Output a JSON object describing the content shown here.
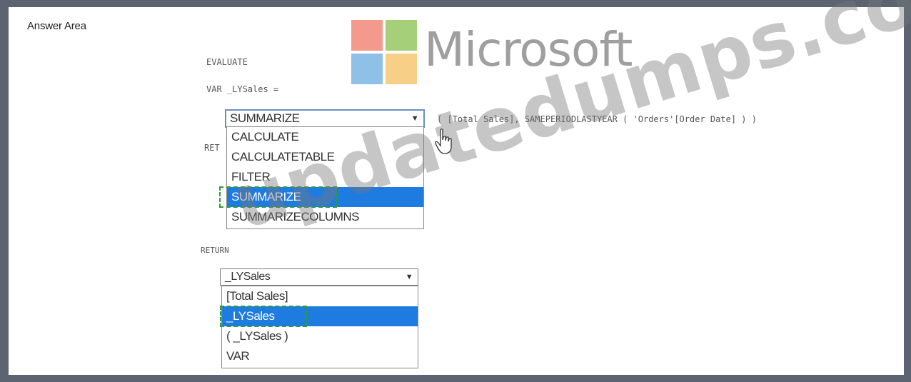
{
  "header": {
    "title": "Answer Area"
  },
  "code": {
    "evaluate": "EVALUATE",
    "var_line": "VAR _LYSales =",
    "func_args": "( [Total Sales], SAMEPERIODLASTYEAR ( 'Orders'[Order Date] ) )",
    "return_partial": "RET",
    "return": "RETURN"
  },
  "dropdown1": {
    "selected": "SUMMARIZE",
    "options": [
      "CALCULATE",
      "CALCULATETABLE",
      "FILTER",
      "SUMMARIZE",
      "SUMMARIZECOLUMNS"
    ],
    "highlighted_index": 3
  },
  "dropdown2": {
    "selected": "_LYSales",
    "options": [
      "[Total Sales]",
      "_LYSales",
      "( _LYSales )",
      "VAR"
    ],
    "highlighted_index": 1
  },
  "logo": {
    "word": "Microsoft",
    "colors": [
      "#f39a8c",
      "#a6cf7a",
      "#8fc0e8",
      "#f8cf86"
    ]
  },
  "watermark": {
    "text": "updatedumps.com"
  },
  "colors": {
    "selection": "#1e7be0",
    "answer_marker": "#2f9a3d",
    "frame": "#5b6470"
  },
  "icons": {
    "dropdown_arrow": "triangle-down-icon",
    "cursor": "hand-pointer-icon"
  }
}
